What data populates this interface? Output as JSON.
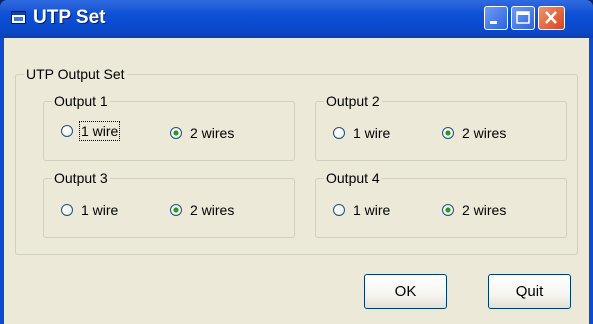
{
  "window": {
    "title": "UTP Set",
    "controls": [
      "minimize-icon",
      "maximize-icon",
      "close-icon"
    ]
  },
  "main_group": {
    "label": "UTP Output Set",
    "outputs": [
      {
        "label": "Output 1",
        "option1": "1 wire",
        "option2": "2 wires",
        "selected": "2 wires",
        "focused": "1 wire"
      },
      {
        "label": "Output 2",
        "option1": "1 wire",
        "option2": "2 wires",
        "selected": "2 wires"
      },
      {
        "label": "Output 3",
        "option1": "1 wire",
        "option2": "2 wires",
        "selected": "2 wires"
      },
      {
        "label": "Output 4",
        "option1": "1 wire",
        "option2": "2 wires",
        "selected": "2 wires"
      }
    ]
  },
  "buttons": {
    "ok": "OK",
    "quit": "Quit"
  },
  "colors": {
    "titlebar": "#0a4bd0",
    "client": "#ece9d8",
    "border": "#0b4bd1"
  }
}
